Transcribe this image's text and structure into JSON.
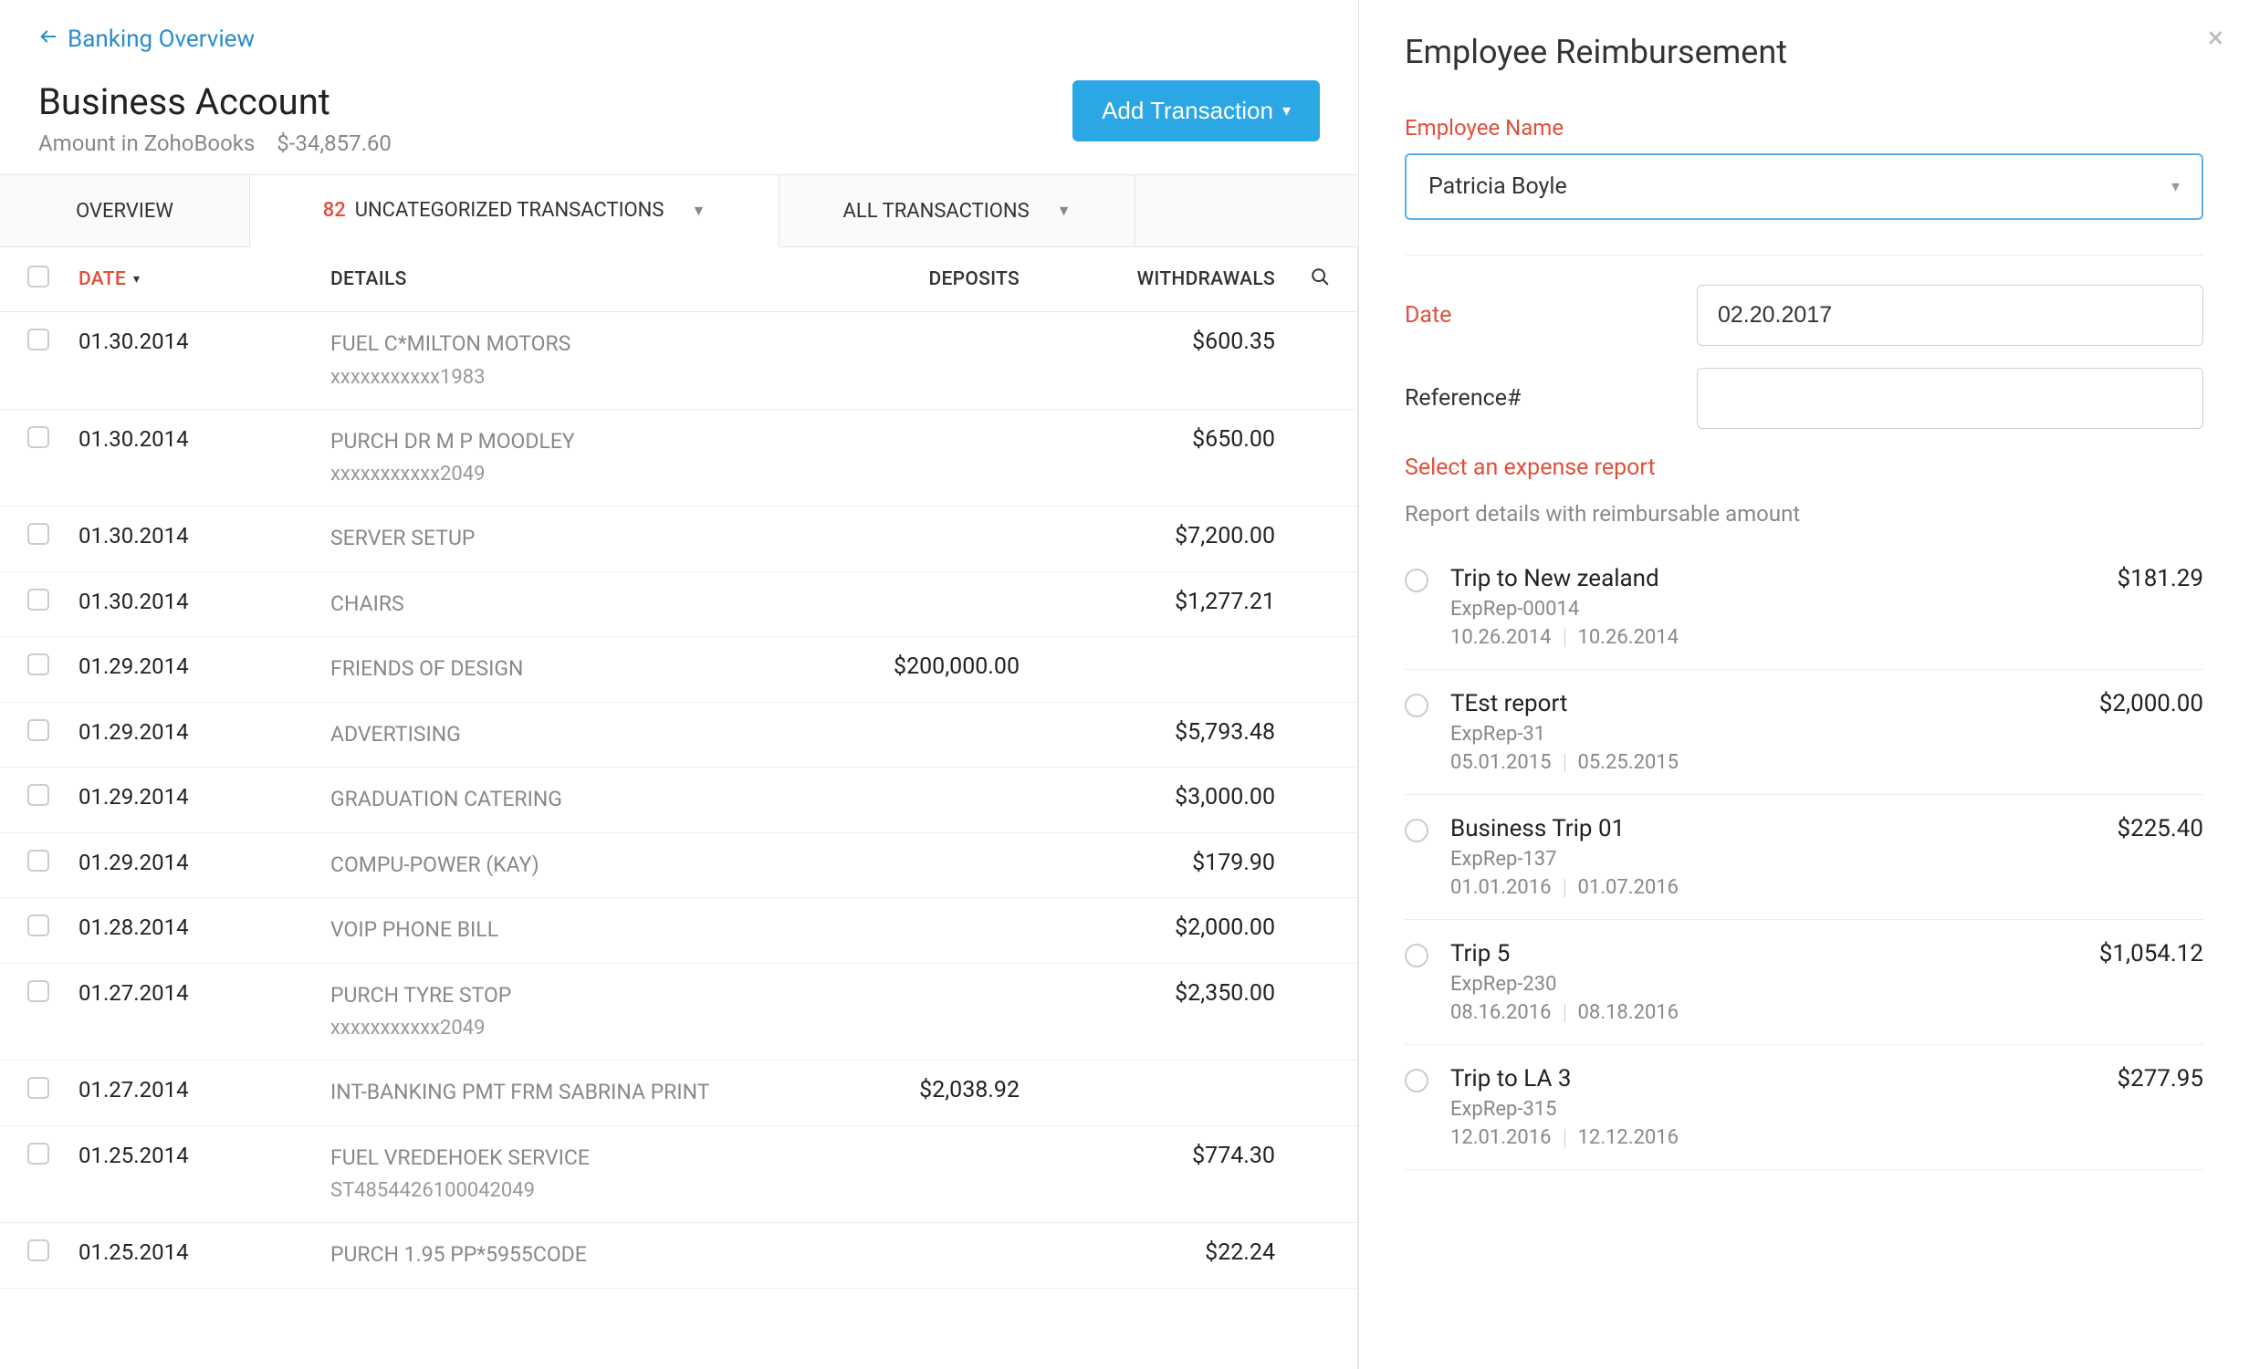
{
  "header": {
    "back_link": "Banking Overview",
    "title": "Business Account",
    "subtitle_label": "Amount in ZohoBooks",
    "subtitle_amount": "$-34,857.60",
    "add_button": "Add Transaction"
  },
  "tabs": {
    "overview": "OVERVIEW",
    "uncat_count": "82",
    "uncat_label": "UNCATEGORIZED TRANSACTIONS",
    "all": "ALL TRANSACTIONS"
  },
  "table": {
    "headers": {
      "date": "DATE",
      "details": "DETAILS",
      "deposits": "DEPOSITS",
      "withdrawals": "WITHDRAWALS"
    },
    "rows": [
      {
        "date": "01.30.2014",
        "details": "FUEL C*MILTON MOTORS",
        "sub": "xxxxxxxxxxx1983",
        "deposit": "",
        "withdrawal": "$600.35"
      },
      {
        "date": "01.30.2014",
        "details": "PURCH DR M P MOODLEY",
        "sub": "xxxxxxxxxxx2049",
        "deposit": "",
        "withdrawal": "$650.00"
      },
      {
        "date": "01.30.2014",
        "details": "SERVER SETUP",
        "sub": "",
        "deposit": "",
        "withdrawal": "$7,200.00"
      },
      {
        "date": "01.30.2014",
        "details": "CHAIRS",
        "sub": "",
        "deposit": "",
        "withdrawal": "$1,277.21"
      },
      {
        "date": "01.29.2014",
        "details": "FRIENDS OF DESIGN",
        "sub": "",
        "deposit": "$200,000.00",
        "withdrawal": ""
      },
      {
        "date": "01.29.2014",
        "details": "ADVERTISING",
        "sub": "",
        "deposit": "",
        "withdrawal": "$5,793.48"
      },
      {
        "date": "01.29.2014",
        "details": "GRADUATION CATERING",
        "sub": "",
        "deposit": "",
        "withdrawal": "$3,000.00"
      },
      {
        "date": "01.29.2014",
        "details": "COMPU-POWER (KAY)",
        "sub": "",
        "deposit": "",
        "withdrawal": "$179.90"
      },
      {
        "date": "01.28.2014",
        "details": "VOIP PHONE BILL",
        "sub": "",
        "deposit": "",
        "withdrawal": "$2,000.00"
      },
      {
        "date": "01.27.2014",
        "details": "PURCH TYRE STOP",
        "sub": "xxxxxxxxxxx2049",
        "deposit": "",
        "withdrawal": "$2,350.00"
      },
      {
        "date": "01.27.2014",
        "details": "INT-BANKING PMT FRM SABRINA PRINT",
        "sub": "",
        "deposit": "$2,038.92",
        "withdrawal": ""
      },
      {
        "date": "01.25.2014",
        "details": "FUEL VREDEHOEK SERVICE",
        "sub": "ST4854426100042049",
        "deposit": "",
        "withdrawal": "$774.30"
      },
      {
        "date": "01.25.2014",
        "details": "PURCH 1.95 PP*5955CODE",
        "sub": "",
        "deposit": "",
        "withdrawal": "$22.24"
      }
    ]
  },
  "panel": {
    "title": "Employee Reimbursement",
    "employee_name_label": "Employee Name",
    "employee_name_value": "Patricia Boyle",
    "date_label": "Date",
    "date_value": "02.20.2017",
    "reference_label": "Reference#",
    "reference_value": "",
    "select_report_label": "Select an expense report",
    "report_hint": "Report details with reimbursable amount",
    "reports": [
      {
        "title": "Trip to New zealand",
        "amount": "$181.29",
        "code": "ExpRep-00014",
        "d1": "10.26.2014",
        "d2": "10.26.2014"
      },
      {
        "title": "TEst report",
        "amount": "$2,000.00",
        "code": "ExpRep-31",
        "d1": "05.01.2015",
        "d2": "05.25.2015"
      },
      {
        "title": "Business Trip 01",
        "amount": "$225.40",
        "code": "ExpRep-137",
        "d1": "01.01.2016",
        "d2": "01.07.2016"
      },
      {
        "title": "Trip 5",
        "amount": "$1,054.12",
        "code": "ExpRep-230",
        "d1": "08.16.2016",
        "d2": "08.18.2016"
      },
      {
        "title": "Trip to LA 3",
        "amount": "$277.95",
        "code": "ExpRep-315",
        "d1": "12.01.2016",
        "d2": "12.12.2016"
      }
    ]
  }
}
